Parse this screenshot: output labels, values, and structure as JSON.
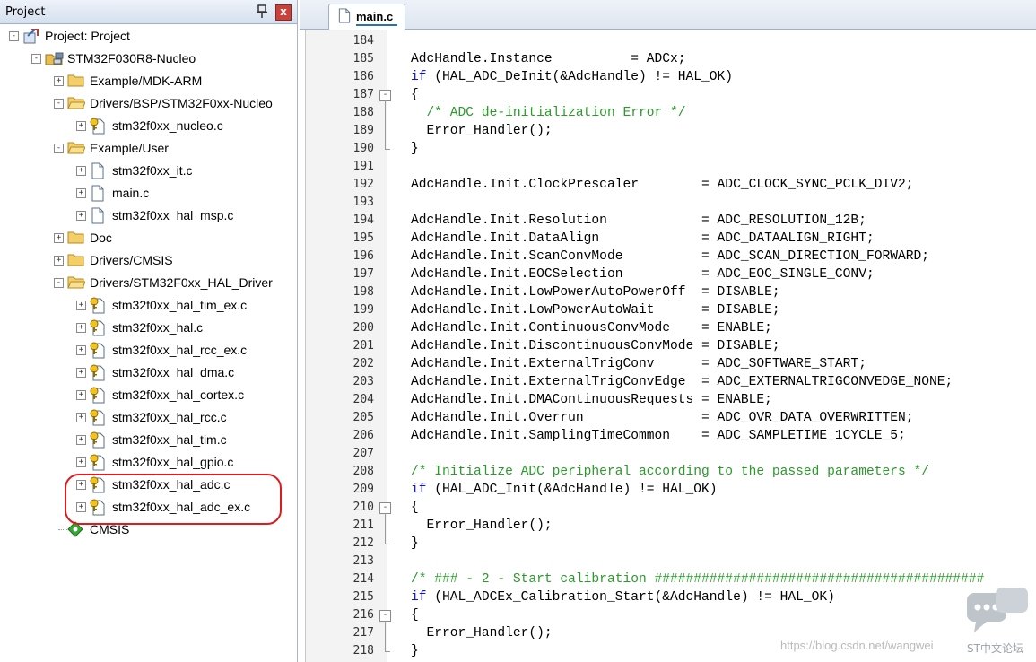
{
  "project_pane": {
    "title": "Project",
    "pin_glyph": "Ѱ",
    "close_glyph": "x",
    "tree": [
      {
        "depth": 0,
        "icon": "project-icon",
        "label": "Project: Project",
        "expander": "-"
      },
      {
        "depth": 1,
        "icon": "target-icon",
        "label": "STM32F030R8-Nucleo",
        "expander": "-"
      },
      {
        "depth": 2,
        "icon": "folder-icon",
        "label": "Example/MDK-ARM",
        "expander": "+"
      },
      {
        "depth": 2,
        "icon": "folder-open-icon",
        "label": "Drivers/BSP/STM32F0xx-Nucleo",
        "expander": "-"
      },
      {
        "depth": 3,
        "icon": "file-key-icon",
        "label": "stm32f0xx_nucleo.c",
        "expander": "+"
      },
      {
        "depth": 2,
        "icon": "folder-open-icon",
        "label": "Example/User",
        "expander": "-"
      },
      {
        "depth": 3,
        "icon": "file-icon",
        "label": "stm32f0xx_it.c",
        "expander": "+"
      },
      {
        "depth": 3,
        "icon": "file-icon",
        "label": "main.c",
        "expander": "+"
      },
      {
        "depth": 3,
        "icon": "file-icon",
        "label": "stm32f0xx_hal_msp.c",
        "expander": "+"
      },
      {
        "depth": 2,
        "icon": "folder-icon",
        "label": "Doc",
        "expander": "+"
      },
      {
        "depth": 2,
        "icon": "folder-icon",
        "label": "Drivers/CMSIS",
        "expander": "+"
      },
      {
        "depth": 2,
        "icon": "folder-open-icon",
        "label": "Drivers/STM32F0xx_HAL_Driver",
        "expander": "-"
      },
      {
        "depth": 3,
        "icon": "file-key-icon",
        "label": "stm32f0xx_hal_tim_ex.c",
        "expander": "+"
      },
      {
        "depth": 3,
        "icon": "file-key-icon",
        "label": "stm32f0xx_hal.c",
        "expander": "+"
      },
      {
        "depth": 3,
        "icon": "file-key-icon",
        "label": "stm32f0xx_hal_rcc_ex.c",
        "expander": "+"
      },
      {
        "depth": 3,
        "icon": "file-key-icon",
        "label": "stm32f0xx_hal_dma.c",
        "expander": "+"
      },
      {
        "depth": 3,
        "icon": "file-key-icon",
        "label": "stm32f0xx_hal_cortex.c",
        "expander": "+"
      },
      {
        "depth": 3,
        "icon": "file-key-icon",
        "label": "stm32f0xx_hal_rcc.c",
        "expander": "+"
      },
      {
        "depth": 3,
        "icon": "file-key-icon",
        "label": "stm32f0xx_hal_tim.c",
        "expander": "+"
      },
      {
        "depth": 3,
        "icon": "file-key-icon",
        "label": "stm32f0xx_hal_gpio.c",
        "expander": "+"
      },
      {
        "depth": 3,
        "icon": "file-key-icon",
        "label": "stm32f0xx_hal_adc.c",
        "expander": "+"
      },
      {
        "depth": 3,
        "icon": "file-key-icon",
        "label": "stm32f0xx_hal_adc_ex.c",
        "expander": "+"
      },
      {
        "depth": 2,
        "icon": "component-icon",
        "label": "CMSIS",
        "expander": ""
      }
    ]
  },
  "editor": {
    "tab_label": "main.c",
    "lines": [
      {
        "n": "184",
        "code": "",
        "fold": ""
      },
      {
        "n": "185",
        "code": "AdcHandle.Instance          = ADCx;",
        "fold": ""
      },
      {
        "n": "186",
        "code": "if (HAL_ADC_DeInit(&AdcHandle) != HAL_OK)",
        "fold": ""
      },
      {
        "n": "187",
        "code": "{",
        "fold": "-"
      },
      {
        "n": "188",
        "code": "  /* ADC de-initialization Error */",
        "fold": ""
      },
      {
        "n": "189",
        "code": "  Error_Handler();",
        "fold": ""
      },
      {
        "n": "190",
        "code": "}",
        "fold": ""
      },
      {
        "n": "191",
        "code": "",
        "fold": ""
      },
      {
        "n": "192",
        "code": "AdcHandle.Init.ClockPrescaler        = ADC_CLOCK_SYNC_PCLK_DIV2;",
        "fold": ""
      },
      {
        "n": "193",
        "code": "",
        "fold": ""
      },
      {
        "n": "194",
        "code": "AdcHandle.Init.Resolution            = ADC_RESOLUTION_12B;",
        "fold": ""
      },
      {
        "n": "195",
        "code": "AdcHandle.Init.DataAlign             = ADC_DATAALIGN_RIGHT;",
        "fold": ""
      },
      {
        "n": "196",
        "code": "AdcHandle.Init.ScanConvMode          = ADC_SCAN_DIRECTION_FORWARD;",
        "fold": ""
      },
      {
        "n": "197",
        "code": "AdcHandle.Init.EOCSelection          = ADC_EOC_SINGLE_CONV;",
        "fold": ""
      },
      {
        "n": "198",
        "code": "AdcHandle.Init.LowPowerAutoPowerOff  = DISABLE;",
        "fold": ""
      },
      {
        "n": "199",
        "code": "AdcHandle.Init.LowPowerAutoWait      = DISABLE;",
        "fold": ""
      },
      {
        "n": "200",
        "code": "AdcHandle.Init.ContinuousConvMode    = ENABLE;",
        "fold": ""
      },
      {
        "n": "201",
        "code": "AdcHandle.Init.DiscontinuousConvMode = DISABLE;",
        "fold": ""
      },
      {
        "n": "202",
        "code": "AdcHandle.Init.ExternalTrigConv      = ADC_SOFTWARE_START;",
        "fold": ""
      },
      {
        "n": "203",
        "code": "AdcHandle.Init.ExternalTrigConvEdge  = ADC_EXTERNALTRIGCONVEDGE_NONE;",
        "fold": ""
      },
      {
        "n": "204",
        "code": "AdcHandle.Init.DMAContinuousRequests = ENABLE;",
        "fold": ""
      },
      {
        "n": "205",
        "code": "AdcHandle.Init.Overrun               = ADC_OVR_DATA_OVERWRITTEN;",
        "fold": ""
      },
      {
        "n": "206",
        "code": "AdcHandle.Init.SamplingTimeCommon    = ADC_SAMPLETIME_1CYCLE_5;",
        "fold": ""
      },
      {
        "n": "207",
        "code": "",
        "fold": ""
      },
      {
        "n": "208",
        "code": "/* Initialize ADC peripheral according to the passed parameters */",
        "fold": ""
      },
      {
        "n": "209",
        "code": "if (HAL_ADC_Init(&AdcHandle) != HAL_OK)",
        "fold": ""
      },
      {
        "n": "210",
        "code": "{",
        "fold": "-"
      },
      {
        "n": "211",
        "code": "  Error_Handler();",
        "fold": ""
      },
      {
        "n": "212",
        "code": "}",
        "fold": ""
      },
      {
        "n": "213",
        "code": "",
        "fold": ""
      },
      {
        "n": "214",
        "code": "/* ### - 2 - Start calibration ##########################################",
        "fold": ""
      },
      {
        "n": "215",
        "code": "if (HAL_ADCEx_Calibration_Start(&AdcHandle) != HAL_OK)",
        "fold": ""
      },
      {
        "n": "216",
        "code": "{",
        "fold": "-"
      },
      {
        "n": "217",
        "code": "  Error_Handler();",
        "fold": ""
      },
      {
        "n": "218",
        "code": "}",
        "fold": ""
      }
    ]
  },
  "watermark": {
    "url": "https://blog.csdn.net/wangwei",
    "text": "ST中文论坛"
  },
  "colors": {
    "keyword": "#1515c8",
    "comment": "#2a9a2a",
    "highlight": "#e01a1a"
  }
}
